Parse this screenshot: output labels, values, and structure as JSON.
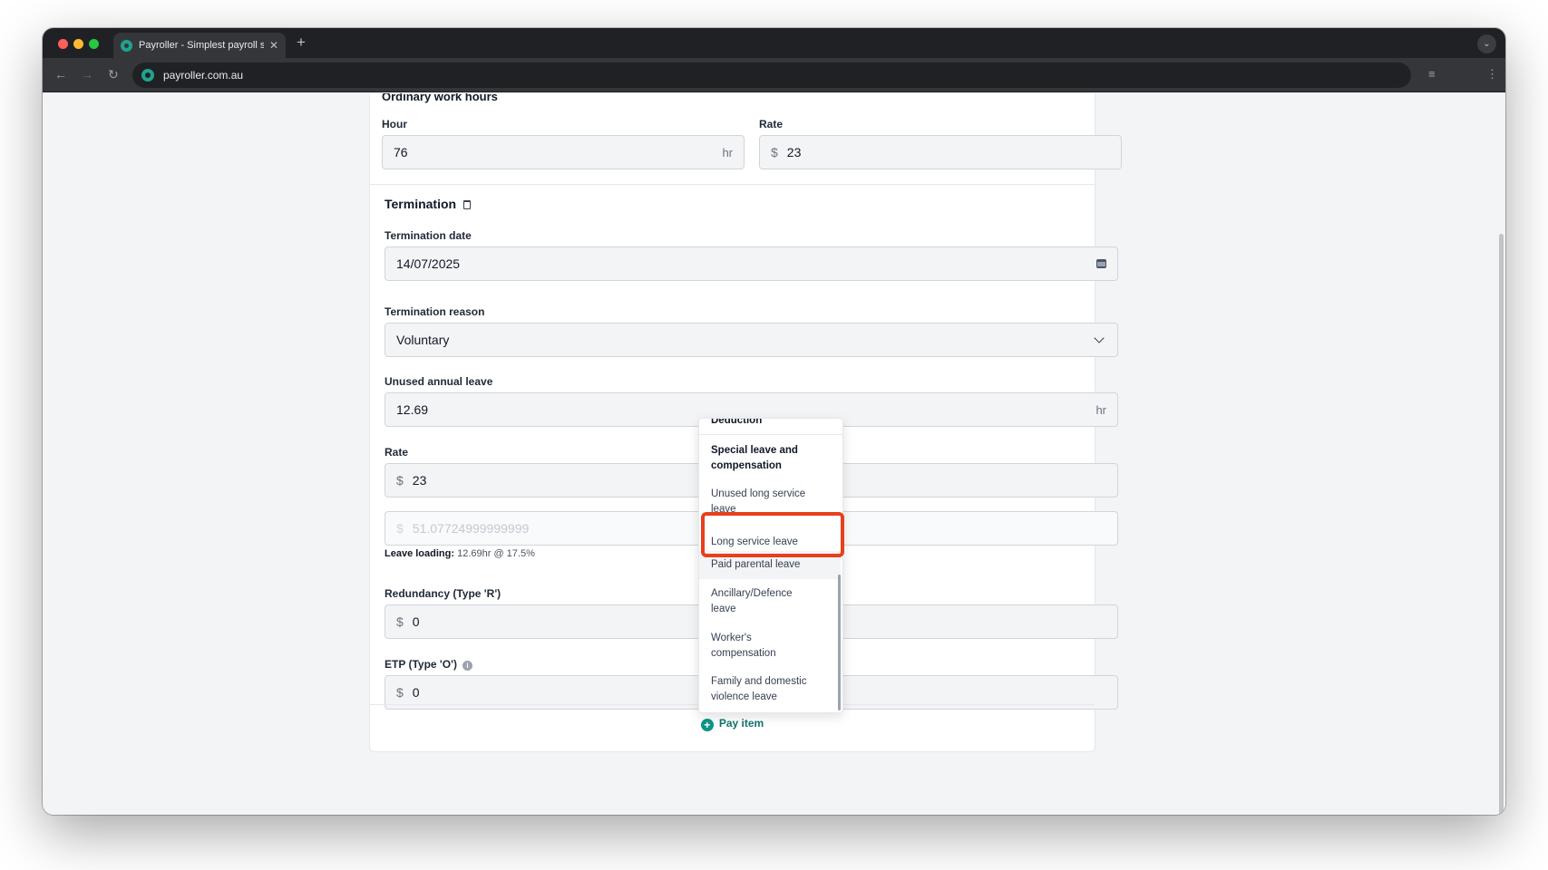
{
  "browser": {
    "tab_title": "Payroller - Simplest payroll so",
    "url": "payroller.com.au",
    "new_tab": "+",
    "tab_close": "✕"
  },
  "ordinary": {
    "title": "Ordinary work hours",
    "hour_label": "Hour",
    "hour_value": "76",
    "hour_suffix": "hr",
    "rate_label": "Rate",
    "rate_prefix": "$",
    "rate_value": "23"
  },
  "termination": {
    "title": "Termination",
    "date_label": "Termination date",
    "date_value": "14/07/2025",
    "reason_label": "Termination reason",
    "reason_value": "Voluntary",
    "unused_label": "Unused annual leave",
    "unused_value": "12.69",
    "unused_suffix": "hr",
    "rate_label": "Rate",
    "rate_prefix": "$",
    "rate_value": "23",
    "loading_prefix": "$",
    "loading_value": "51.07724999999999",
    "loading_note_label": "Leave loading:",
    "loading_note_value": "12.69hr @ 17.5%",
    "redundancy_label": "Redundancy (Type 'R')",
    "redundancy_prefix": "$",
    "redundancy_value": "0",
    "etp_label": "ETP (Type 'O')",
    "etp_prefix": "$",
    "etp_value": "0"
  },
  "pay_item": "Pay item",
  "dropdown": {
    "items": [
      {
        "label": "Deduction",
        "group": true
      },
      {
        "label": "Special leave and compensation",
        "group": true
      },
      {
        "label": "Unused long service leave"
      },
      {
        "label": "Long service leave"
      },
      {
        "label": "Paid parental leave"
      },
      {
        "label": "Ancillary/Defence leave"
      },
      {
        "label": "Worker's compensation"
      },
      {
        "label": "Family and domestic violence leave"
      }
    ]
  },
  "colors": {
    "accent": "#0f9488",
    "highlight": "#e8401c"
  }
}
